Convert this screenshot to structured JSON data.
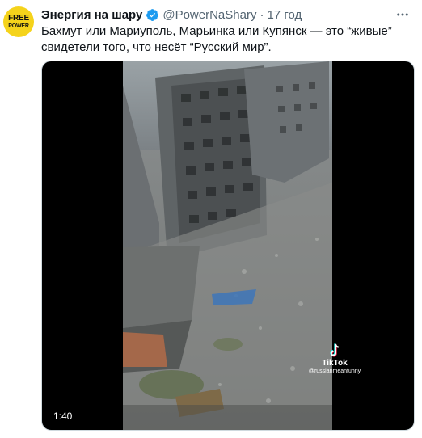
{
  "tweet": {
    "avatar": {
      "line1": "FREE",
      "line2": "POWER",
      "color": "#f5d31b"
    },
    "display_name": "Энергия на шару",
    "verified_icon": "verified-badge-icon",
    "handle": "@PowerNaShary",
    "separator": "·",
    "timestamp": "17 год",
    "more_icon": "more-dots-icon",
    "text_line1": "Бахмут или Мариуполь, Марьинка или Купянск — это “живые”",
    "text_line2": "свидетели того, что несёт “Русский мир”.",
    "accent_color": "#1d9bf0"
  },
  "media": {
    "type": "video",
    "duration": "1:40",
    "watermark_app": "TikTok",
    "watermark_user": "@russianmeanfunny"
  }
}
